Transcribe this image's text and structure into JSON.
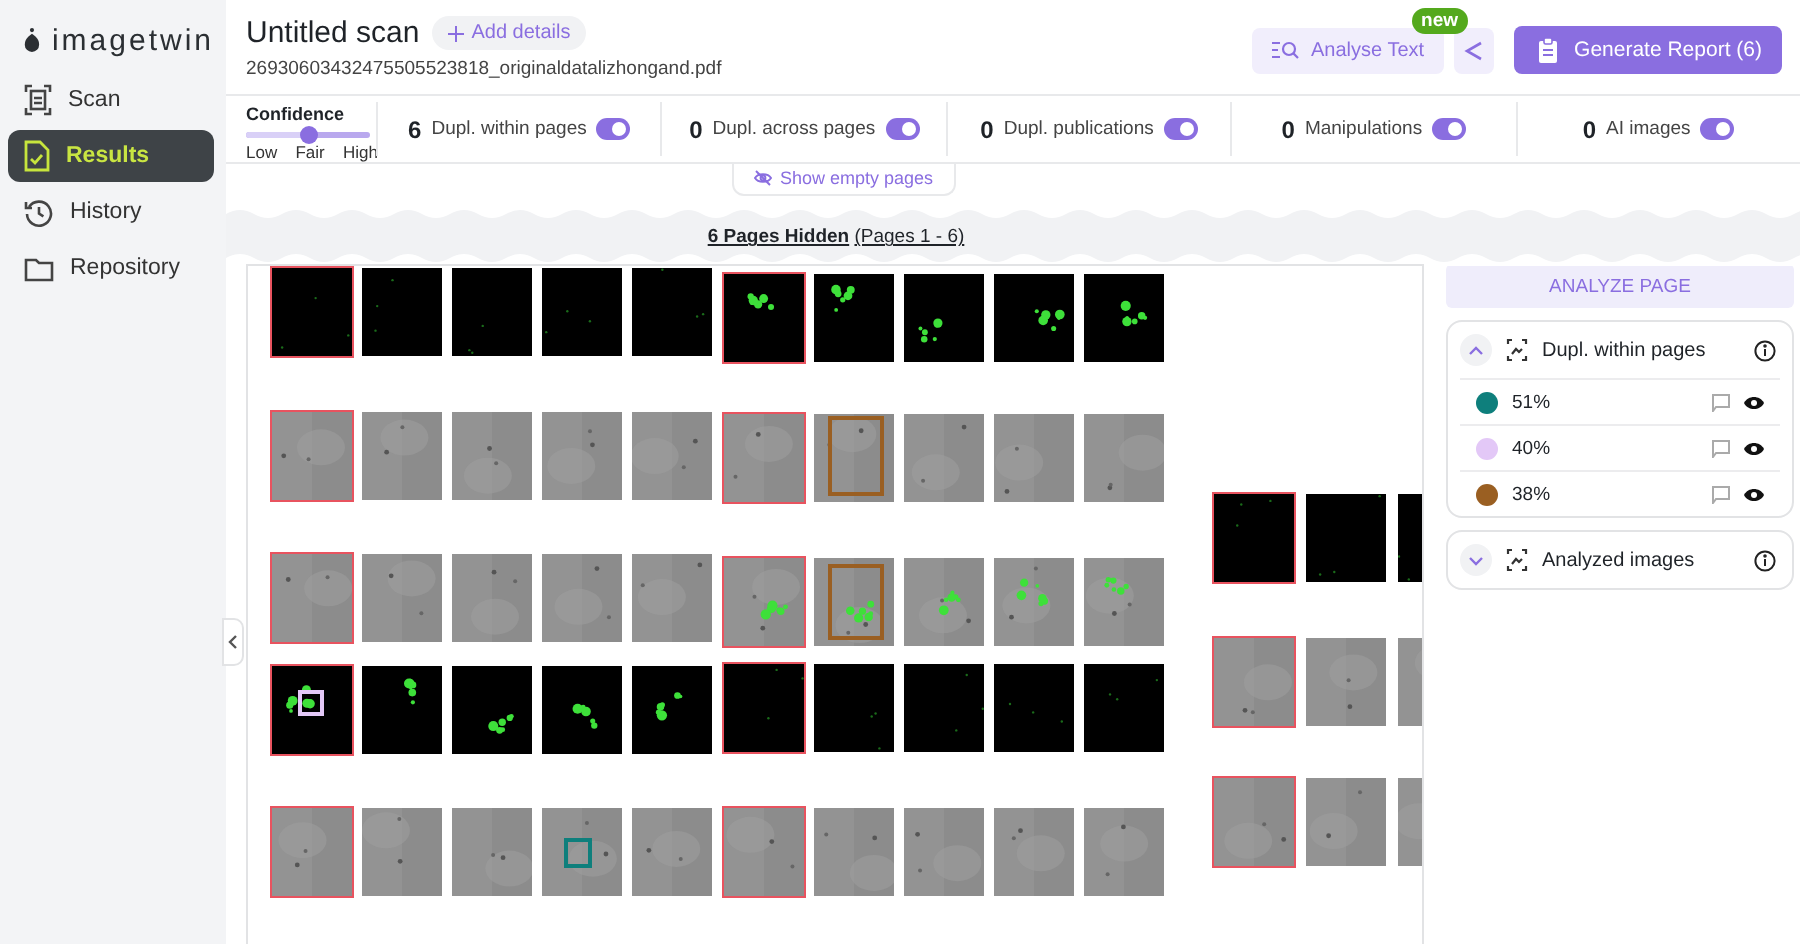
{
  "app": {
    "logo": "imagetwin"
  },
  "sidebar": {
    "items": [
      {
        "label": "Scan",
        "selected": false
      },
      {
        "label": "Results",
        "selected": true
      },
      {
        "label": "History",
        "selected": false
      },
      {
        "label": "Repository",
        "selected": false
      }
    ]
  },
  "header": {
    "title": "Untitled scan",
    "add_details": "Add details",
    "filename": "26930603432475505523818_originaldatalizhongand.pdf",
    "analyse_text": "Analyse Text",
    "new_badge": "new",
    "generate_report": "Generate Report (6)"
  },
  "confidence": {
    "label": "Confidence",
    "level": 0.5,
    "options": [
      "Low",
      "Fair",
      "High"
    ]
  },
  "filters": [
    {
      "count": "6",
      "label": "Dupl. within pages",
      "on": true
    },
    {
      "count": "0",
      "label": "Dupl. across pages",
      "on": true
    },
    {
      "count": "0",
      "label": "Dupl. publications",
      "on": true
    },
    {
      "count": "0",
      "label": "Manipulations",
      "on": true
    },
    {
      "count": "0",
      "label": "AI images",
      "on": true
    }
  ],
  "show_empty_pages": "Show empty pages",
  "hidden_notice": {
    "count_text": "6 Pages Hidden",
    "range": "(Pages 1 - 6)"
  },
  "analyze_page": "ANALYZE PAGE",
  "panels": [
    {
      "title": "Dupl. within pages",
      "expanded": true,
      "matches": [
        {
          "percent": "51%",
          "color": "#0e7f7c"
        },
        {
          "percent": "40%",
          "color": "#e3c8f7"
        },
        {
          "percent": "38%",
          "color": "#9a5f22"
        }
      ]
    },
    {
      "title": "Analyzed images",
      "expanded": false
    }
  ]
}
